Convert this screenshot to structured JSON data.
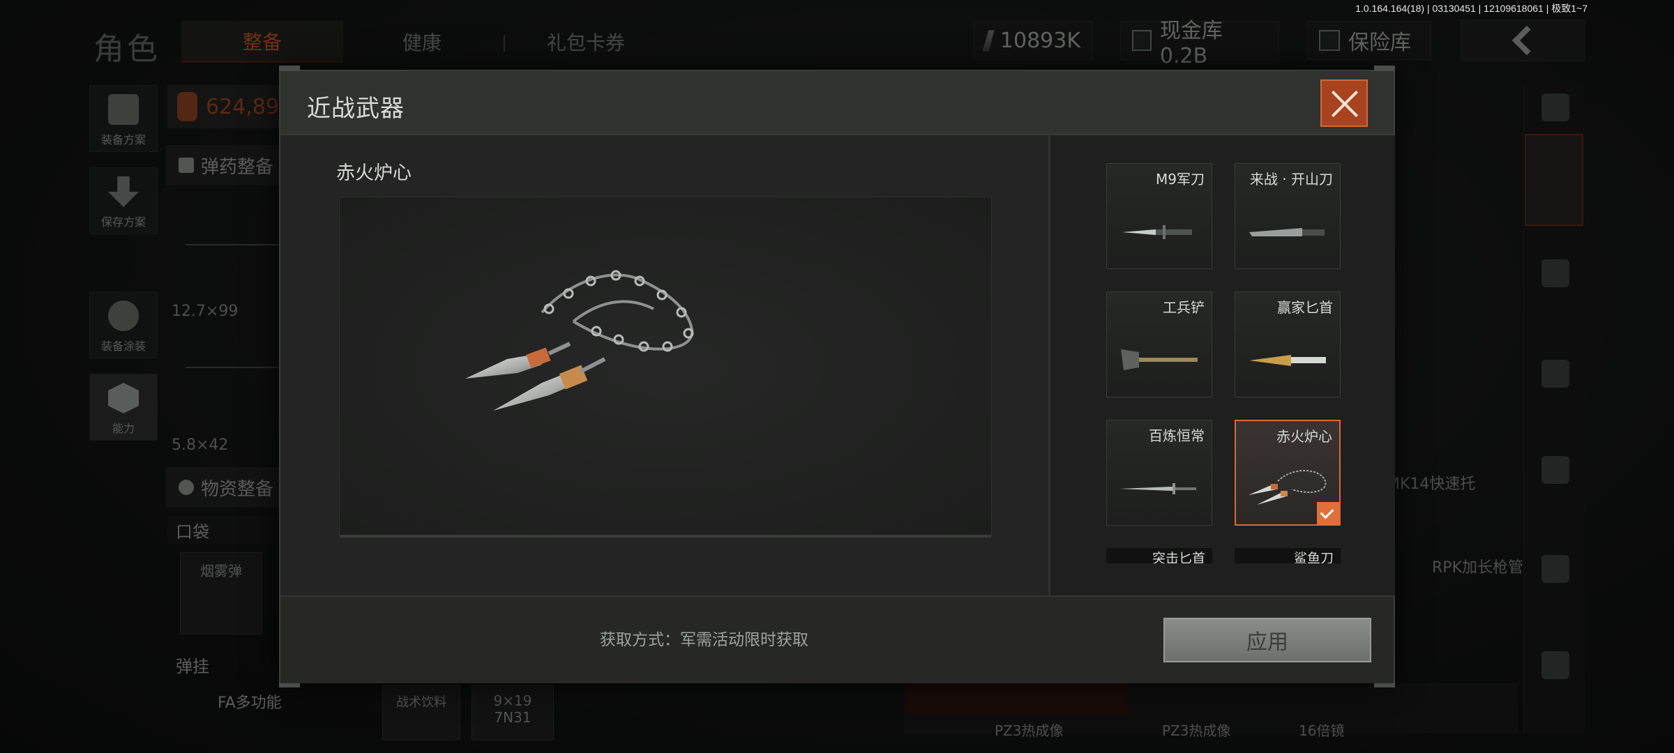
{
  "version": "1.0.164.164(18) | 03130451 | 12109618061 | 极致1~7",
  "page_title": "角色",
  "top_tabs": [
    "整备",
    "健康",
    "礼包卡券"
  ],
  "resources": {
    "currency": "10893K",
    "cash_vault": "现金库 0.2B",
    "insurance_vault": "保险库"
  },
  "left_sidebar": {
    "items": [
      "装备方案",
      "保存方案",
      "装备涂装",
      "能力"
    ]
  },
  "background": {
    "money": "624,89",
    "ammo_button": "弹药整备",
    "supplies_button": "物资整备",
    "caliber_1": "12.7×99",
    "caliber_2": "5.8×42",
    "pocket": "口袋",
    "smoke": "烟雾弹",
    "hanging": "弹挂",
    "fa_multi": "FA多功能",
    "ammo_9": "9×19",
    "ammo_7n": "7N31",
    "mk14": "MK14快速托",
    "rpk": "RPK加长枪管",
    "pz3_a": "PZ3热成像",
    "pz3_b": "PZ3热成像",
    "scope16": "16倍镜"
  },
  "modal": {
    "title": "近战武器",
    "selected_item_name": "赤火炉心",
    "acquire_text": "获取方式：军需活动限时获取",
    "apply_label": "应用",
    "options": [
      {
        "label": "M9军刀",
        "icon": "bayonet-icon"
      },
      {
        "label": "来战 · 开山刀",
        "icon": "machete-icon"
      },
      {
        "label": "工兵铲",
        "icon": "shovel-icon"
      },
      {
        "label": "赢家匕首",
        "icon": "dagger-icon"
      },
      {
        "label": "百炼恒常",
        "icon": "sword-icon"
      },
      {
        "label": "赤火炉心",
        "icon": "chain-blades-icon",
        "selected": true
      },
      {
        "label": "突击匕首",
        "icon": "dagger-icon"
      },
      {
        "label": "鲨鱼刀",
        "icon": "knife-icon"
      }
    ]
  },
  "colors": {
    "accent": "#e0703a",
    "close_bg": "#a8421f",
    "active_tab": "#ff6a2a"
  }
}
